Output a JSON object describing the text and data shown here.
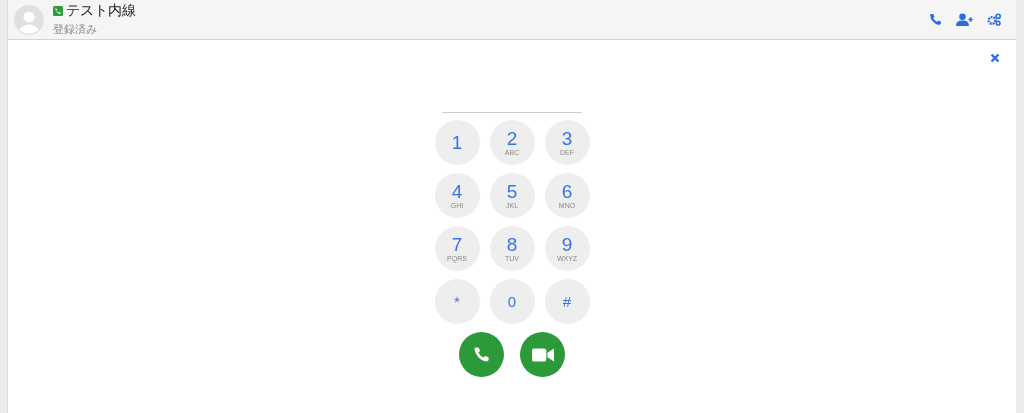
{
  "header": {
    "name": "テスト内線",
    "status": "登録済み"
  },
  "keys": [
    {
      "digit": "1"
    },
    {
      "digit": "2",
      "letters": "ABC"
    },
    {
      "digit": "3",
      "letters": "DEF"
    },
    {
      "digit": "4",
      "letters": "GHI"
    },
    {
      "digit": "5",
      "letters": "JKL"
    },
    {
      "digit": "6",
      "letters": "MNO"
    },
    {
      "digit": "7",
      "letters": "PQRS"
    },
    {
      "digit": "8",
      "letters": "TUV"
    },
    {
      "digit": "9",
      "letters": "WXYZ"
    },
    {
      "digit": "*"
    },
    {
      "digit": "0"
    },
    {
      "digit": "#"
    }
  ],
  "call_buttons": [
    {
      "kind": "voice"
    },
    {
      "kind": "video"
    }
  ]
}
